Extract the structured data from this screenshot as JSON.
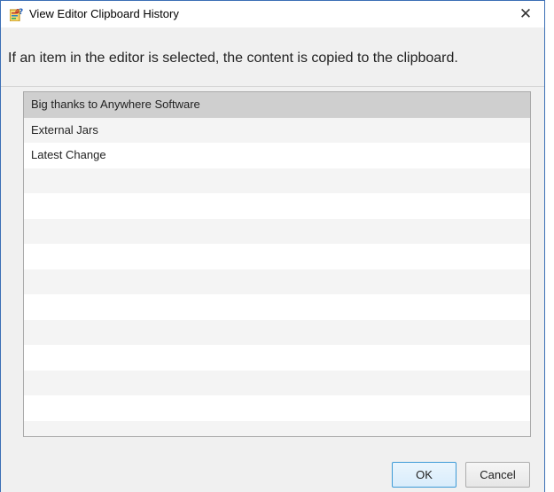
{
  "window": {
    "title": "View Editor Clipboard History",
    "close_glyph": "✕",
    "app_icon": "app-logo-icon"
  },
  "message": "If an item in the editor is selected, the content is copied to the clipboard.",
  "list": {
    "items": [
      "Big thanks to Anywhere Software",
      "External Jars",
      "Latest Change",
      "",
      "",
      "",
      "",
      "",
      "",
      "",
      "",
      "",
      "",
      ""
    ],
    "selected_index": 0
  },
  "buttons": {
    "ok_label": "OK",
    "cancel_label": "Cancel"
  },
  "colors": {
    "accent_border": "#3b6fb5",
    "selection": "#cfcfcf",
    "default_button_border": "#3c9ad6"
  }
}
